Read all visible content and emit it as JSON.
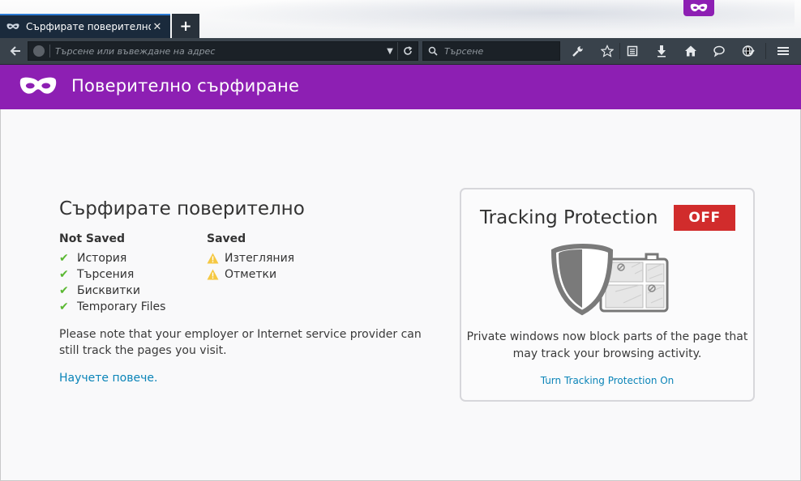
{
  "tab": {
    "title": "Сърфирате поверително",
    "close_label": "✕",
    "new_tab_label": "+"
  },
  "toolbar": {
    "url_placeholder": "Търсене или въвеждане на адрес",
    "search_placeholder": "Търсене"
  },
  "banner": {
    "title": "Поверително сърфиране"
  },
  "private_info": {
    "heading": "Сърфирате поверително",
    "not_saved_title": "Not Saved",
    "not_saved_items": [
      "История",
      "Търсения",
      "Бисквитки",
      "Temporary Files"
    ],
    "saved_title": "Saved",
    "saved_items": [
      "Изтегляния",
      "Отметки"
    ],
    "note": "Please note that your employer or Internet service provider can still track the pages you visit.",
    "learn_more": "Научете повече."
  },
  "tracking": {
    "title": "Tracking Protection",
    "status": "OFF",
    "description": "Private windows now block parts of the page that may track your browsing activity.",
    "link": "Turn Tracking Protection On"
  },
  "colors": {
    "private_purple": "#8d1fb3",
    "off_red": "#d12c2c",
    "check_green": "#5ab832",
    "warn_yellow": "#f5c842",
    "link_blue": "#0a84b8"
  }
}
